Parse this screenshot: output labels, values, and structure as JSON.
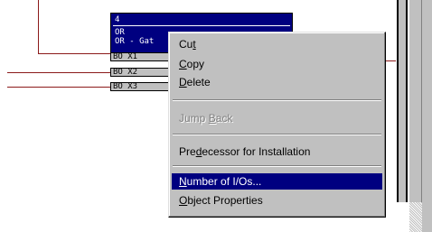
{
  "block": {
    "number": "4",
    "type": "OR",
    "name": "OR - Gat",
    "pins": [
      "BO X1",
      "BO X2",
      "BO X3"
    ]
  },
  "context_menu": {
    "items": [
      {
        "pre": "Cu",
        "acc": "t",
        "post": "",
        "state": "normal"
      },
      {
        "pre": "",
        "acc": "C",
        "post": "opy",
        "state": "normal"
      },
      {
        "pre": "",
        "acc": "D",
        "post": "elete",
        "state": "normal"
      },
      {
        "pre": "Jump ",
        "acc": "B",
        "post": "ack",
        "state": "disabled"
      },
      {
        "pre": "Pre",
        "acc": "d",
        "post": "ecessor for Installation",
        "state": "normal"
      },
      {
        "pre": "",
        "acc": "N",
        "post": "umber of I/Os...",
        "state": "selected"
      },
      {
        "pre": "",
        "acc": "O",
        "post": "bject Properties",
        "state": "normal"
      }
    ]
  },
  "colors": {
    "wire": "#8b1a1a",
    "block_header": "#000080",
    "menu_background": "#c0c0c0",
    "selection": "#000080"
  }
}
